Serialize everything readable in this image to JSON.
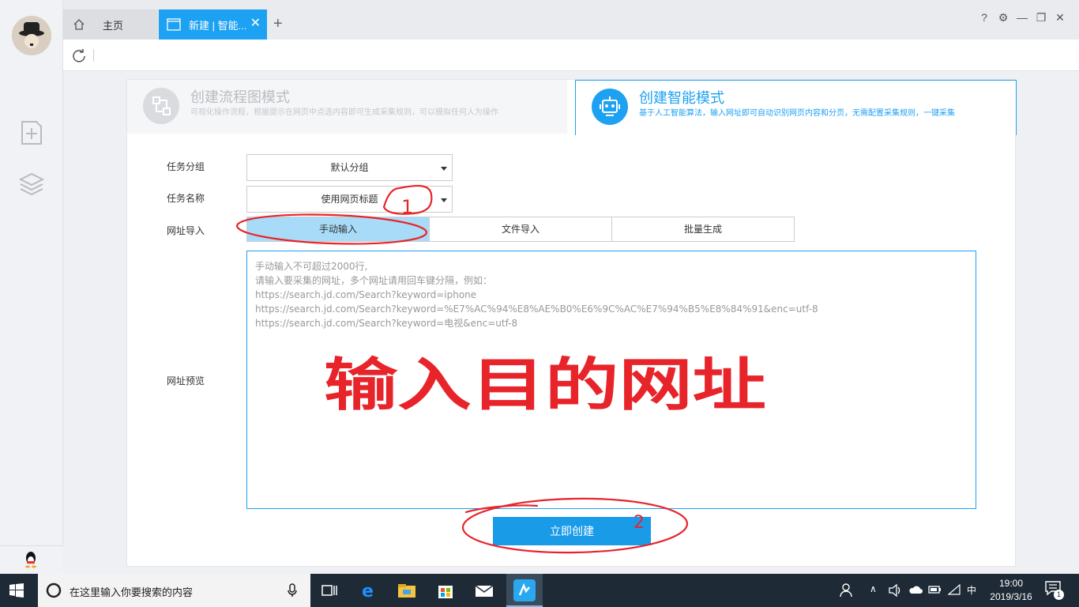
{
  "tabs": {
    "home_label": "主页",
    "active_label": "新建 | 智能...",
    "add_label": "+",
    "close_label": "✕"
  },
  "window_controls": [
    "?",
    "⚙",
    "—",
    "❐",
    "✕"
  ],
  "modes": {
    "flow": {
      "title": "创建流程图模式",
      "desc": "可视化操作流程，根据提示在网页中点选内容即可生成采集规则，可以模拟任何人为操作"
    },
    "smart": {
      "title": "创建智能模式",
      "desc": "基于人工智能算法，输入网址即可自动识别网页内容和分页，无需配置采集规则，一键采集"
    }
  },
  "form": {
    "group_label": "任务分组",
    "group_value": "默认分组",
    "name_label": "任务名称",
    "name_value": "使用网页标题",
    "url_import_label": "网址导入",
    "import_options": [
      "手动输入",
      "文件导入",
      "批量生成"
    ],
    "selected_import": "手动输入",
    "url_preview_label": "网址预览",
    "url_placeholder": "手动输入不可超过2000行,\n请输入要采集的网址，多个网址请用回车键分隔，例如：\nhttps://search.jd.com/Search?keyword=iphone\nhttps://search.jd.com/Search?keyword=%E7%AC%94%E8%AE%B0%E6%9C%AC%E7%94%B5%E8%84%91&enc=utf-8\nhttps://search.jd.com/Search?keyword=电视&enc=utf-8",
    "create_button": "立即创建"
  },
  "annotations": {
    "note_1": "1",
    "note_2": "2",
    "handwritten": "输入目的网址"
  },
  "taskbar": {
    "search_placeholder": "在这里输入你要搜索的内容",
    "ime": "中",
    "time": "19:00",
    "date": "2019/3/16",
    "notification_count": "1"
  },
  "colors": {
    "accent": "#1da1f2",
    "annotation": "#e8242b",
    "taskbar": "#1e2a36"
  }
}
